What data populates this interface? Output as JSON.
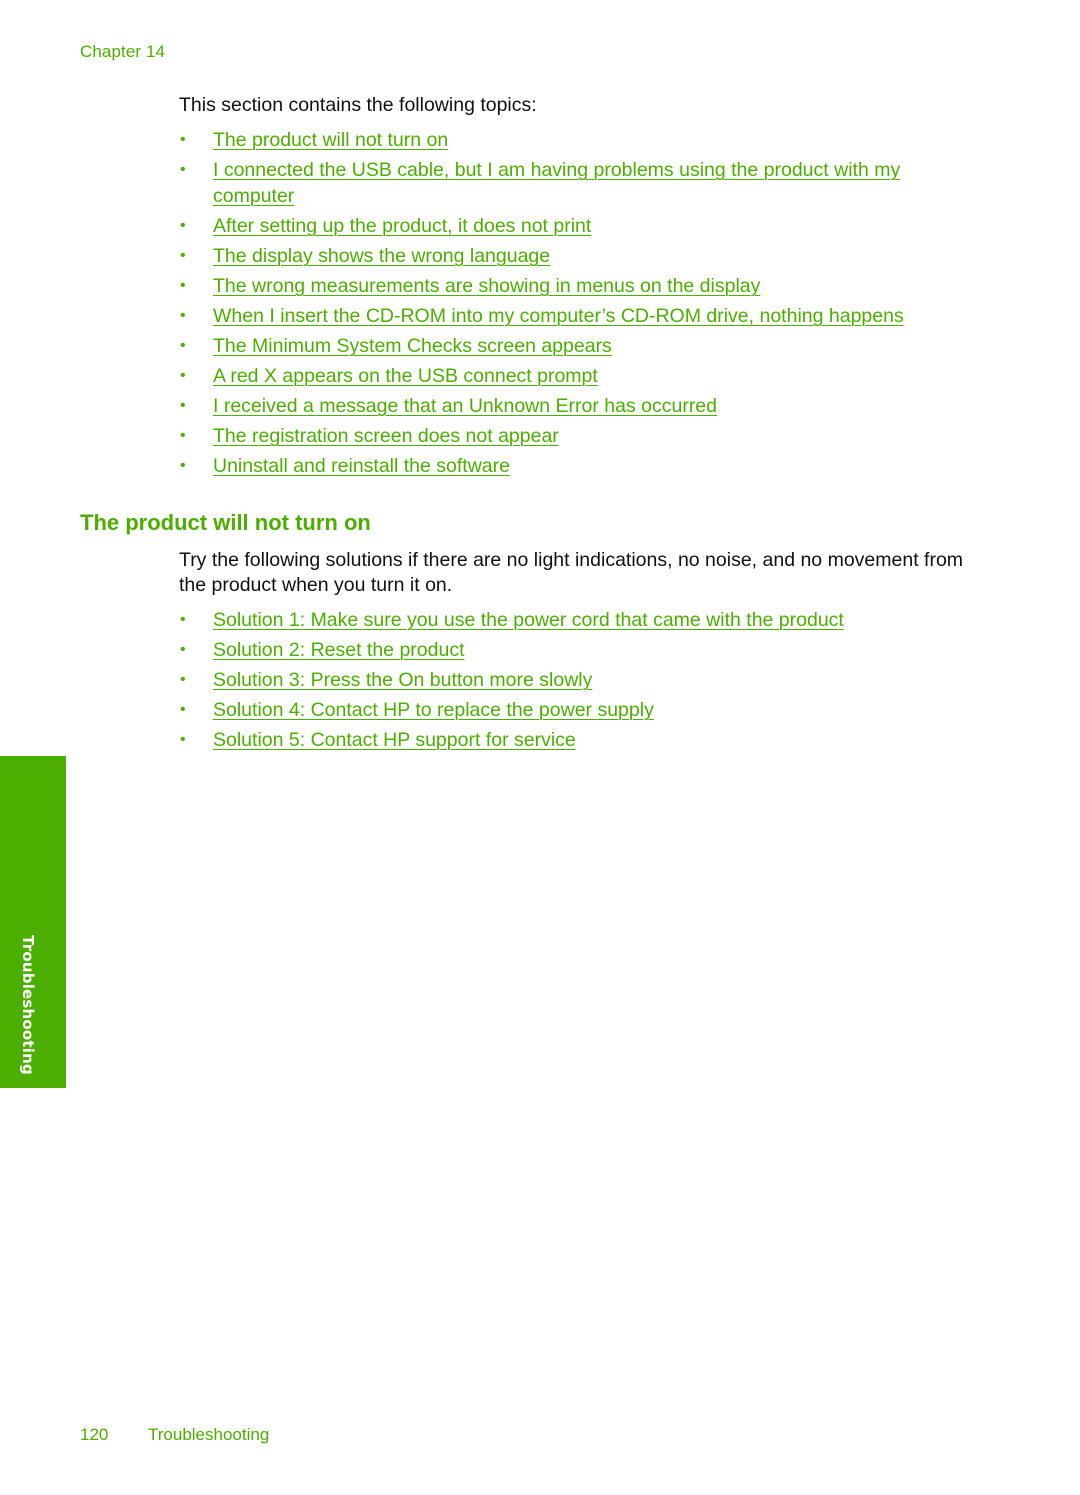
{
  "header": {
    "chapter": "Chapter 14"
  },
  "intro": {
    "text": "This section contains the following topics:"
  },
  "topics": [
    {
      "label": "The product will not turn on"
    },
    {
      "label": "I connected the USB cable, but I am having problems using the product with my computer"
    },
    {
      "label": "After setting up the product, it does not print"
    },
    {
      "label": "The display shows the wrong language"
    },
    {
      "label": "The wrong measurements are showing in menus on the display"
    },
    {
      "label": "When I insert the CD-ROM into my computer’s CD-ROM drive, nothing happens"
    },
    {
      "label": "The Minimum System Checks screen appears"
    },
    {
      "label": "A red X appears on the USB connect prompt"
    },
    {
      "label": "I received a message that an Unknown Error has occurred"
    },
    {
      "label": "The registration screen does not appear"
    },
    {
      "label": "Uninstall and reinstall the software"
    }
  ],
  "section": {
    "heading": "The product will not turn on",
    "paragraph": "Try the following solutions if there are no light indications, no noise, and no movement from the product when you turn it on.",
    "solutions": [
      {
        "label": "Solution 1: Make sure you use the power cord that came with the product"
      },
      {
        "label": "Solution 2: Reset the product"
      },
      {
        "label": "Solution 3: Press the On button more slowly"
      },
      {
        "label": "Solution 4: Contact HP to replace the power supply"
      },
      {
        "label": "Solution 5: Contact HP support for service"
      }
    ]
  },
  "side_tab": {
    "label": "Troubleshooting"
  },
  "footer": {
    "page_number": "120",
    "section_name": "Troubleshooting"
  },
  "colors": {
    "accent": "#4caf00",
    "text": "#111111"
  }
}
